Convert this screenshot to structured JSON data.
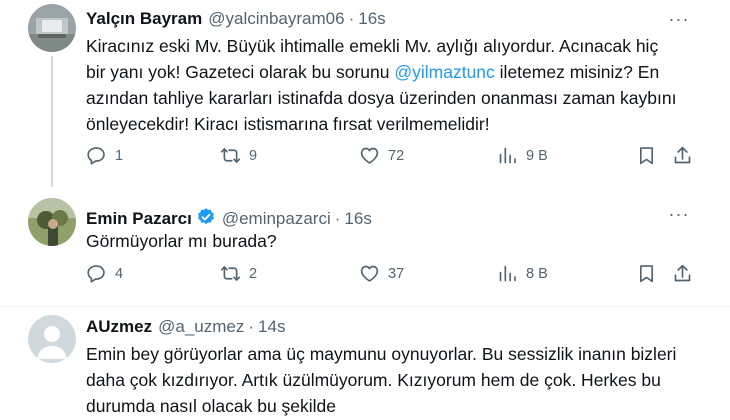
{
  "tweets": [
    {
      "name": "Yalçın Bayram",
      "handle": "@yalcinbayram06",
      "time": "16s",
      "verified": false,
      "text_lines": [
        "Kiracınız eski Mv. Büyük ihtimalle emekli Mv. aylığı alıyordur. Acınacak hiç",
        "bir yanı yok! Gazeteci olarak bu sorunu ",
        "iletemez misiniz? En",
        "azından tahliye kararları istinafda dosya üzerinden onanması zaman kaybını",
        "önleyecekdir! Kiracı istismarına fırsat verilmemelidir!"
      ],
      "mention": "@yilmaztunc",
      "replies": "1",
      "retweets": "9",
      "likes": "72",
      "views": "9 B"
    },
    {
      "name": "Emin Pazarcı",
      "handle": "@eminpazarci",
      "time": "16s",
      "verified": true,
      "text_lines": [
        "Görmüyorlar mı burada?"
      ],
      "replies": "4",
      "retweets": "2",
      "likes": "37",
      "views": "8 B"
    },
    {
      "name": "AUzmez",
      "handle": "@a_uzmez",
      "time": "14s",
      "verified": false,
      "text_lines": [
        "Emin bey görüyorlar ama üç maymunu oynuyorlar. Bu sessizlik inanın bizleri",
        "daha çok kızdırıyor. Artık üzülmüyorum. Kızıyorum hem de çok. Herkes bu",
        "durumda nasıl olacak bu şekilde"
      ]
    }
  ],
  "separator": "·",
  "more_label": "···",
  "colors": {
    "accent": "#1d9bf0",
    "secondary_text": "#536471",
    "divider": "#eff3f4",
    "thread_line": "#cfd9de"
  },
  "icons": [
    "reply-icon",
    "retweet-icon",
    "like-icon",
    "views-icon",
    "bookmark-icon",
    "share-icon",
    "verified-icon",
    "more-icon"
  ]
}
